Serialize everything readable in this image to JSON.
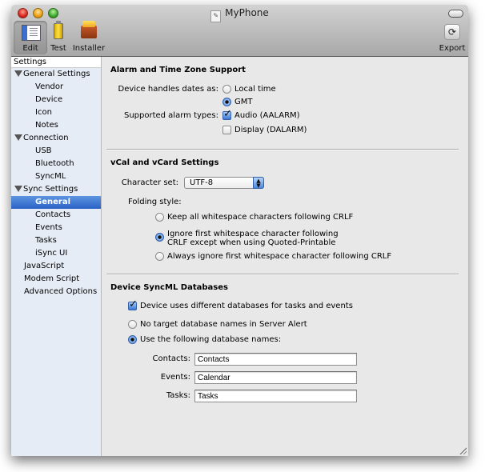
{
  "window": {
    "title": "MyPhone"
  },
  "toolbar": {
    "items": [
      {
        "label": "Edit",
        "icon": "edit-icon",
        "selected": true
      },
      {
        "label": "Test",
        "icon": "spray-can-icon"
      },
      {
        "label": "Installer",
        "icon": "package-icon"
      },
      {
        "label": "Export",
        "icon": "export-icon"
      }
    ]
  },
  "sidebar": {
    "header": "Settings",
    "items": [
      {
        "label": "General Settings",
        "level": 0,
        "expanded": true
      },
      {
        "label": "Vendor",
        "level": 1
      },
      {
        "label": "Device",
        "level": 1
      },
      {
        "label": "Icon",
        "level": 1
      },
      {
        "label": "Notes",
        "level": 1
      },
      {
        "label": "Connection",
        "level": 0,
        "expanded": true
      },
      {
        "label": "USB",
        "level": 1
      },
      {
        "label": "Bluetooth",
        "level": 1
      },
      {
        "label": "SyncML",
        "level": 1
      },
      {
        "label": "Sync Settings",
        "level": 0,
        "expanded": true
      },
      {
        "label": "General",
        "level": 1,
        "selected": true
      },
      {
        "label": "Contacts",
        "level": 1
      },
      {
        "label": "Events",
        "level": 1
      },
      {
        "label": "Tasks",
        "level": 1
      },
      {
        "label": "iSync UI",
        "level": 1
      },
      {
        "label": "JavaScript",
        "level": 0
      },
      {
        "label": "Modem Script",
        "level": 0
      },
      {
        "label": "Advanced Options",
        "level": 0
      }
    ]
  },
  "alarm": {
    "title": "Alarm and Time Zone Support",
    "dates_label": "Device handles dates as:",
    "dates_options": [
      {
        "label": "Local time",
        "selected": false
      },
      {
        "label": "GMT",
        "selected": true
      }
    ],
    "alarm_label": "Supported alarm types:",
    "alarm_options": [
      {
        "label": "Audio (AALARM)",
        "checked": true
      },
      {
        "label": "Display (DALARM)",
        "checked": false
      }
    ]
  },
  "vcal": {
    "title": "vCal and vCard Settings",
    "charset_label": "Character set:",
    "charset_value": "UTF-8",
    "folding_label": "Folding style:",
    "folding_options": [
      {
        "label": "Keep all whitespace characters following CRLF",
        "selected": false
      },
      {
        "label": "Ignore first whitespace character following",
        "label2": "CRLF except when using Quoted-Printable",
        "selected": true
      },
      {
        "label": "Always ignore first whitespace character following CRLF",
        "selected": false
      }
    ]
  },
  "databases": {
    "title": "Device SyncML Databases",
    "different_db_label": "Device uses different databases for tasks and events",
    "different_db_checked": true,
    "no_target_label": "No target database names in Server Alert",
    "use_names_label": "Use the following database names:",
    "use_names_selected": true,
    "fields": [
      {
        "label": "Contacts:",
        "value": "Contacts"
      },
      {
        "label": "Events:",
        "value": "Calendar"
      },
      {
        "label": "Tasks:",
        "value": "Tasks"
      }
    ]
  }
}
